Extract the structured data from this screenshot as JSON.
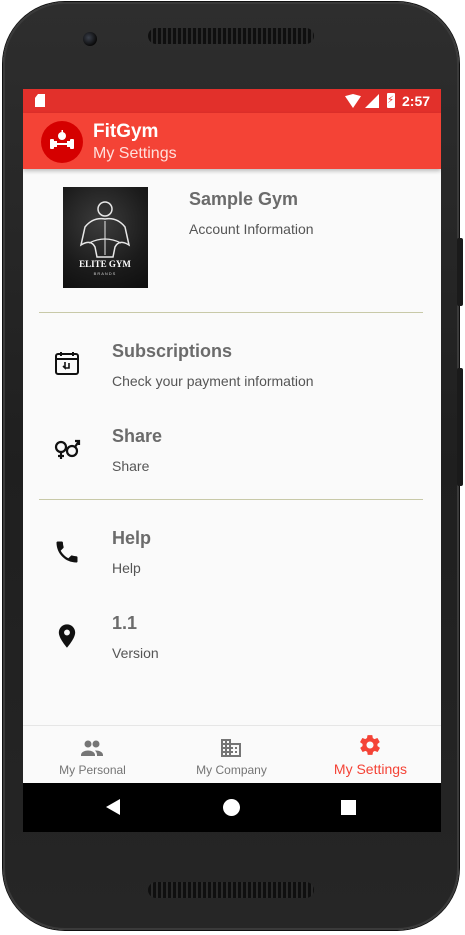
{
  "status_bar": {
    "time": "2:57"
  },
  "app_bar": {
    "title": "FitGym",
    "subtitle": "My Settings"
  },
  "profile": {
    "gym_name": "Sample Gym",
    "account_label": "Account Information",
    "image_text": "ELITE GYM",
    "image_subtext": "BRANDS"
  },
  "settings_items": [
    {
      "icon": "subscription-calendar-icon",
      "title": "Subscriptions",
      "subtitle": "Check your payment information"
    },
    {
      "icon": "share-gender-icon",
      "title": "Share",
      "subtitle": "Share"
    },
    {
      "icon": "phone-icon",
      "title": "Help",
      "subtitle": "Help"
    },
    {
      "icon": "location-pin-icon",
      "title": "1.1",
      "subtitle": "Version"
    }
  ],
  "bottom_nav": [
    {
      "icon": "people-icon",
      "label": "My Personal",
      "active": false
    },
    {
      "icon": "building-icon",
      "label": "My Company",
      "active": false
    },
    {
      "icon": "gear-icon",
      "label": "My Settings",
      "active": true
    }
  ],
  "colors": {
    "primary": "#f44336",
    "primary_dark": "#e2302b",
    "active_nav": "#f44336",
    "divider": "#c8c9a8"
  }
}
